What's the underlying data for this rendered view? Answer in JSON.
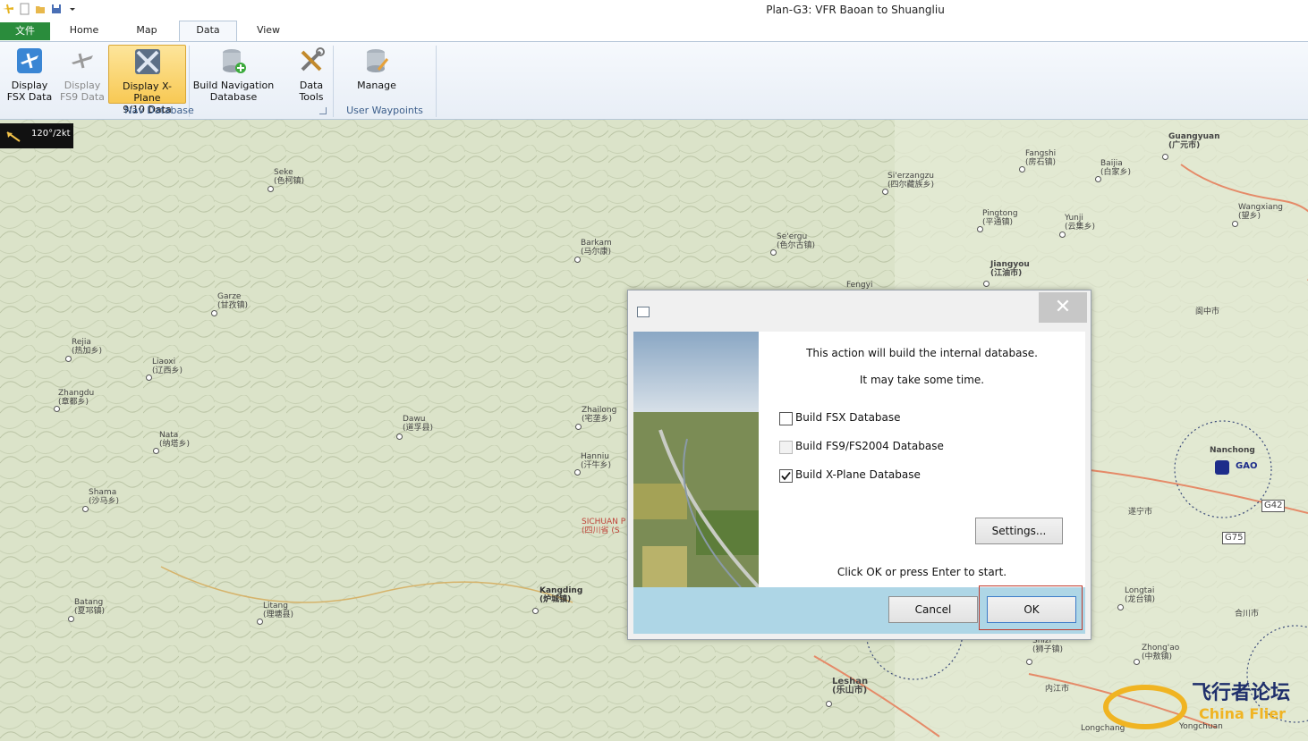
{
  "window": {
    "title": "Plan-G3: VFR Baoan to Shuangliu"
  },
  "tabs": {
    "file": "文件",
    "home": "Home",
    "map": "Map",
    "data": "Data",
    "view": "View"
  },
  "ribbon": {
    "display_fsx": [
      "Display",
      "FSX Data"
    ],
    "display_fs9": [
      "Display",
      "FS9 Data"
    ],
    "display_xplane": [
      "Display X-Plane",
      "9/10 Data"
    ],
    "build_nav": [
      "Build Navigation",
      "Database"
    ],
    "data_tools": [
      "Data",
      "Tools"
    ],
    "manage": "Manage",
    "group_nav": "Nav Database",
    "group_waypoints": "User Waypoints"
  },
  "wind": {
    "readout": "120°/2kt"
  },
  "map_labels": [
    {
      "name": "Seke",
      "cn": "(色柯镇)"
    },
    {
      "name": "Barkam",
      "cn": "(马尔康)"
    },
    {
      "name": "Se'ergu",
      "cn": "(色尔古镇)"
    },
    {
      "name": "Garze",
      "cn": "(甘孜镇)"
    },
    {
      "name": "Rejia",
      "cn": "(热加乡)"
    },
    {
      "name": "Liaoxi",
      "cn": "(辽西乡)"
    },
    {
      "name": "Zhangdu",
      "cn": "(章都乡)"
    },
    {
      "name": "Dawu",
      "cn": "(道孚县)"
    },
    {
      "name": "Nata",
      "cn": "(纳塔乡)"
    },
    {
      "name": "Shama",
      "cn": "(沙马乡)"
    },
    {
      "name": "Zhailong",
      "cn": "(宅垄乡)"
    },
    {
      "name": "Hanniu",
      "cn": "(汗牛乡)"
    },
    {
      "name": "Batang",
      "cn": "(夏邛镇)"
    },
    {
      "name": "Litang",
      "cn": "(理塘县)"
    },
    {
      "name": "Kangding",
      "cn": "(炉城镇)"
    },
    {
      "name": "Guangyuan",
      "cn": "(广元市)"
    },
    {
      "name": "Fangshi",
      "cn": "(房石镇)"
    },
    {
      "name": "Baijia",
      "cn": "(白家乡)"
    },
    {
      "name": "Si'erzangzu",
      "cn": "(四尔藏族乡)"
    },
    {
      "name": "Pingtong",
      "cn": "(平通镇)"
    },
    {
      "name": "Yunji",
      "cn": "(云集乡)"
    },
    {
      "name": "Wangxiang",
      "cn": "(望乡)"
    },
    {
      "name": "Jiangyou",
      "cn": "(江油市)"
    },
    {
      "name": "Fengyi",
      "cn": ""
    },
    {
      "name": "Nanchong",
      "cn": ""
    },
    {
      "name": "Longtai",
      "cn": "(龙台镇)"
    },
    {
      "name": "Zhong'ao",
      "cn": "(中敖镇)"
    },
    {
      "name": "Shizi",
      "cn": "(狮子镇)"
    },
    {
      "name": "Leshan",
      "cn": "(乐山市)"
    },
    {
      "name": "Longchang",
      "cn": ""
    },
    {
      "name": "Yongchuan",
      "cn": ""
    }
  ],
  "map_misc": {
    "sichuan": "SICHUAN P",
    "sichuan_cn": "(四川省 (S",
    "gao": "GAO",
    "g42": "G42",
    "g75": "G75",
    "hechuan": "合川市",
    "suining": "遂宁市",
    "langzhong": "阆中市",
    "neijiang": "内江市",
    "watermark": "飞行者论坛",
    "watermark2": "China Flier"
  },
  "dialog": {
    "line1": "This action will build the internal database.",
    "line2": "It may take some time.",
    "cb_fsx": "Build FSX Database",
    "cb_fs9": "Build FS9/FS2004 Database",
    "cb_xplane": "Build X-Plane Database",
    "cb_fsx_checked": false,
    "cb_fs9_checked": false,
    "cb_xplane_checked": true,
    "settings": "Settings...",
    "hint": "Click OK or press Enter to start.",
    "cancel": "Cancel",
    "ok": "OK",
    "close": "✕"
  }
}
